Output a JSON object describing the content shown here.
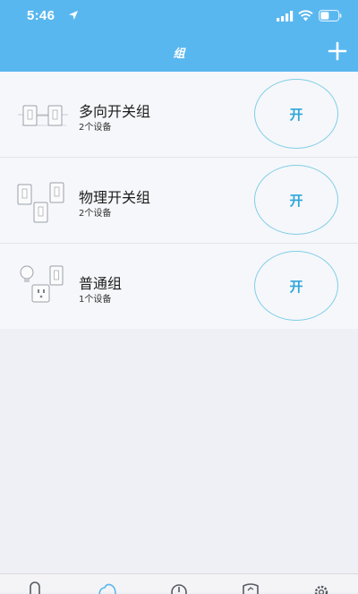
{
  "status_bar": {
    "time": "5:46",
    "icons": [
      "location-arrow-icon",
      "signal-icon",
      "wifi-icon",
      "battery-icon"
    ]
  },
  "header": {
    "title": "组",
    "add_icon": "plus-icon",
    "background": "#59b7ef"
  },
  "groups": [
    {
      "name": "多向开关组",
      "count": "2个设备",
      "button_label": "开",
      "icon": "multi-switch-icon"
    },
    {
      "name": "物理开关组",
      "count": "2个设备",
      "button_label": "开",
      "icon": "physical-switch-icon"
    },
    {
      "name": "普通组",
      "count": "1个设备",
      "button_label": "开",
      "icon": "general-group-icon"
    }
  ],
  "tab_bar": {
    "icons": [
      "home-icon",
      "cloud-icon",
      "clock-icon",
      "shield-icon",
      "gear-icon"
    ]
  },
  "colors": {
    "accent": "#59b7ef",
    "button_border": "#7fcfe6",
    "button_text": "#2fa7d8",
    "page_bg": "#eff0f5"
  }
}
